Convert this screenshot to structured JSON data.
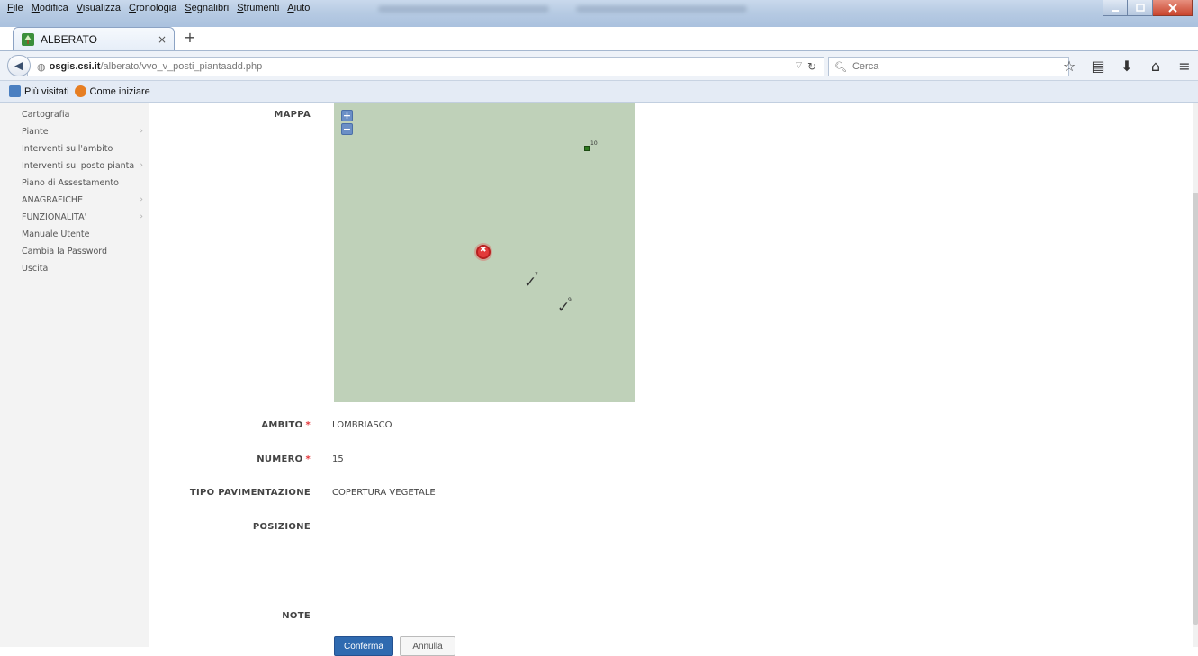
{
  "browser": {
    "menu": [
      "File",
      "Modifica",
      "Visualizza",
      "Cronologia",
      "Segnalibri",
      "Strumenti",
      "Aiuto"
    ],
    "tab": {
      "title": "ALBERATO",
      "close": "×",
      "new_tab": "+"
    },
    "url": {
      "host": "osgis.csi.it",
      "path": "/alberato/vvo_v_posti_piantaadd.php"
    },
    "search": {
      "placeholder": "Cerca"
    },
    "bookmarks": [
      {
        "label": "Più visitati",
        "icon": "most-visited-icon",
        "color": "#4a7fc1"
      },
      {
        "label": "Come iniziare",
        "icon": "firefox-icon",
        "color": "#e67e22"
      }
    ],
    "nav_icons": [
      "star-icon",
      "reading-list-icon",
      "download-icon",
      "home-icon",
      "menu-icon"
    ]
  },
  "sidebar": {
    "items": [
      {
        "label": "Cartografia",
        "submenu": false
      },
      {
        "label": "Piante",
        "submenu": true
      },
      {
        "label": "Interventi sull'ambito",
        "submenu": false
      },
      {
        "label": "Interventi sul posto pianta",
        "submenu": true
      },
      {
        "label": "Piano di Assestamento",
        "submenu": false
      },
      {
        "label": "ANAGRAFICHE",
        "submenu": true
      },
      {
        "label": "FUNZIONALITA'",
        "submenu": true
      },
      {
        "label": "Manuale Utente",
        "submenu": false
      },
      {
        "label": "Cambia la Password",
        "submenu": false
      },
      {
        "label": "Uscita",
        "submenu": false
      }
    ]
  },
  "form": {
    "map_label": "MAPPA",
    "map": {
      "zoom_in": "+",
      "zoom_out": "−",
      "feature_labels": {
        "square": "10",
        "check1": "7",
        "check2": "9"
      },
      "colors": {
        "background": "#bfd1b9",
        "selected": "#e23a3a",
        "existing": "#2e7a1f"
      }
    },
    "fields": {
      "ambito": {
        "label": "AMBITO",
        "required": "*",
        "value": "LOMBRIASCO"
      },
      "numero": {
        "label": "NUMERO",
        "required": "*",
        "value": "15"
      },
      "tipo_pavimentazione": {
        "label": "TIPO PAVIMENTAZIONE",
        "value": "COPERTURA VEGETALE"
      },
      "posizione": {
        "label": "POSIZIONE",
        "value": ""
      },
      "note": {
        "label": "NOTE",
        "value": ""
      }
    },
    "buttons": {
      "confirm": "Conferma",
      "cancel": "Annulla"
    }
  }
}
